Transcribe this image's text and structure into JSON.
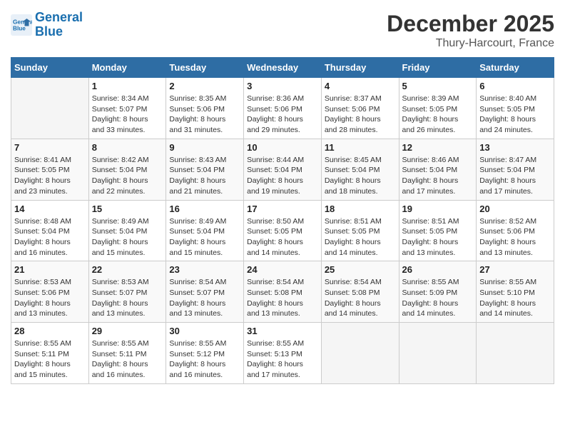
{
  "header": {
    "logo_line1": "General",
    "logo_line2": "Blue",
    "month": "December 2025",
    "location": "Thury-Harcourt, France"
  },
  "weekdays": [
    "Sunday",
    "Monday",
    "Tuesday",
    "Wednesday",
    "Thursday",
    "Friday",
    "Saturday"
  ],
  "weeks": [
    [
      {
        "day": "",
        "info": ""
      },
      {
        "day": "1",
        "info": "Sunrise: 8:34 AM\nSunset: 5:07 PM\nDaylight: 8 hours\nand 33 minutes."
      },
      {
        "day": "2",
        "info": "Sunrise: 8:35 AM\nSunset: 5:06 PM\nDaylight: 8 hours\nand 31 minutes."
      },
      {
        "day": "3",
        "info": "Sunrise: 8:36 AM\nSunset: 5:06 PM\nDaylight: 8 hours\nand 29 minutes."
      },
      {
        "day": "4",
        "info": "Sunrise: 8:37 AM\nSunset: 5:06 PM\nDaylight: 8 hours\nand 28 minutes."
      },
      {
        "day": "5",
        "info": "Sunrise: 8:39 AM\nSunset: 5:05 PM\nDaylight: 8 hours\nand 26 minutes."
      },
      {
        "day": "6",
        "info": "Sunrise: 8:40 AM\nSunset: 5:05 PM\nDaylight: 8 hours\nand 24 minutes."
      }
    ],
    [
      {
        "day": "7",
        "info": "Sunrise: 8:41 AM\nSunset: 5:05 PM\nDaylight: 8 hours\nand 23 minutes."
      },
      {
        "day": "8",
        "info": "Sunrise: 8:42 AM\nSunset: 5:04 PM\nDaylight: 8 hours\nand 22 minutes."
      },
      {
        "day": "9",
        "info": "Sunrise: 8:43 AM\nSunset: 5:04 PM\nDaylight: 8 hours\nand 21 minutes."
      },
      {
        "day": "10",
        "info": "Sunrise: 8:44 AM\nSunset: 5:04 PM\nDaylight: 8 hours\nand 19 minutes."
      },
      {
        "day": "11",
        "info": "Sunrise: 8:45 AM\nSunset: 5:04 PM\nDaylight: 8 hours\nand 18 minutes."
      },
      {
        "day": "12",
        "info": "Sunrise: 8:46 AM\nSunset: 5:04 PM\nDaylight: 8 hours\nand 17 minutes."
      },
      {
        "day": "13",
        "info": "Sunrise: 8:47 AM\nSunset: 5:04 PM\nDaylight: 8 hours\nand 17 minutes."
      }
    ],
    [
      {
        "day": "14",
        "info": "Sunrise: 8:48 AM\nSunset: 5:04 PM\nDaylight: 8 hours\nand 16 minutes."
      },
      {
        "day": "15",
        "info": "Sunrise: 8:49 AM\nSunset: 5:04 PM\nDaylight: 8 hours\nand 15 minutes."
      },
      {
        "day": "16",
        "info": "Sunrise: 8:49 AM\nSunset: 5:04 PM\nDaylight: 8 hours\nand 15 minutes."
      },
      {
        "day": "17",
        "info": "Sunrise: 8:50 AM\nSunset: 5:05 PM\nDaylight: 8 hours\nand 14 minutes."
      },
      {
        "day": "18",
        "info": "Sunrise: 8:51 AM\nSunset: 5:05 PM\nDaylight: 8 hours\nand 14 minutes."
      },
      {
        "day": "19",
        "info": "Sunrise: 8:51 AM\nSunset: 5:05 PM\nDaylight: 8 hours\nand 13 minutes."
      },
      {
        "day": "20",
        "info": "Sunrise: 8:52 AM\nSunset: 5:06 PM\nDaylight: 8 hours\nand 13 minutes."
      }
    ],
    [
      {
        "day": "21",
        "info": "Sunrise: 8:53 AM\nSunset: 5:06 PM\nDaylight: 8 hours\nand 13 minutes."
      },
      {
        "day": "22",
        "info": "Sunrise: 8:53 AM\nSunset: 5:07 PM\nDaylight: 8 hours\nand 13 minutes."
      },
      {
        "day": "23",
        "info": "Sunrise: 8:54 AM\nSunset: 5:07 PM\nDaylight: 8 hours\nand 13 minutes."
      },
      {
        "day": "24",
        "info": "Sunrise: 8:54 AM\nSunset: 5:08 PM\nDaylight: 8 hours\nand 13 minutes."
      },
      {
        "day": "25",
        "info": "Sunrise: 8:54 AM\nSunset: 5:08 PM\nDaylight: 8 hours\nand 14 minutes."
      },
      {
        "day": "26",
        "info": "Sunrise: 8:55 AM\nSunset: 5:09 PM\nDaylight: 8 hours\nand 14 minutes."
      },
      {
        "day": "27",
        "info": "Sunrise: 8:55 AM\nSunset: 5:10 PM\nDaylight: 8 hours\nand 14 minutes."
      }
    ],
    [
      {
        "day": "28",
        "info": "Sunrise: 8:55 AM\nSunset: 5:11 PM\nDaylight: 8 hours\nand 15 minutes."
      },
      {
        "day": "29",
        "info": "Sunrise: 8:55 AM\nSunset: 5:11 PM\nDaylight: 8 hours\nand 16 minutes."
      },
      {
        "day": "30",
        "info": "Sunrise: 8:55 AM\nSunset: 5:12 PM\nDaylight: 8 hours\nand 16 minutes."
      },
      {
        "day": "31",
        "info": "Sunrise: 8:55 AM\nSunset: 5:13 PM\nDaylight: 8 hours\nand 17 minutes."
      },
      {
        "day": "",
        "info": ""
      },
      {
        "day": "",
        "info": ""
      },
      {
        "day": "",
        "info": ""
      }
    ]
  ]
}
